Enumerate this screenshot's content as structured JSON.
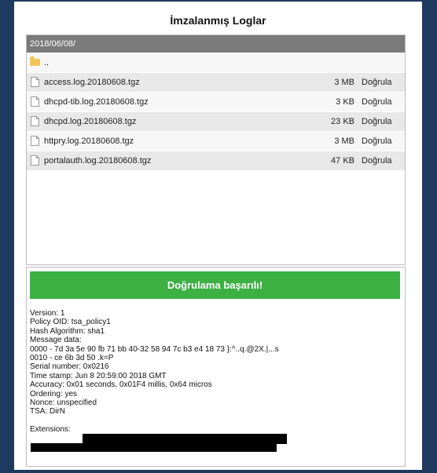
{
  "title": "İmzalanmış Loglar",
  "path": "2018/06/08/",
  "updir_label": "..",
  "verify_label": "Doğrula",
  "files": [
    {
      "name": "access.log.20180608.tgz",
      "size": "3 MB"
    },
    {
      "name": "dhcpd-tib.log.20180608.tgz",
      "size": "3 KB"
    },
    {
      "name": "dhcpd.log.20180608.tgz",
      "size": "23 KB"
    },
    {
      "name": "httpry.log.20180608.tgz",
      "size": "3 MB"
    },
    {
      "name": "portalauth.log.20180608.tgz",
      "size": "47 KB"
    }
  ],
  "result": {
    "banner": "Doğrulama başarılı!",
    "lines": [
      "Version: 1",
      "Policy OID: tsa_policy1",
      "Hash Algorithm: sha1",
      "Message data:",
      "0000 - 7d 3a 5e 90 fb 71 bb 40-32 58 94 7c b3 e4 18 73 }:^..q.@2X.|...s",
      "0010 - ce 6b 3d 50 .k=P",
      "Serial number: 0x0216",
      "Time stamp: Jun 8 20:59:00 2018 GMT",
      "Accuracy: 0x01 seconds, 0x01F4 millis, 0x64 micros",
      "Ordering: yes",
      "Nonce: unspecified",
      "TSA: DirN",
      "",
      "Extensions:"
    ]
  },
  "colors": {
    "success": "#3cb043",
    "pathbar": "#7a7a7a",
    "background": "#1e3a5f"
  }
}
